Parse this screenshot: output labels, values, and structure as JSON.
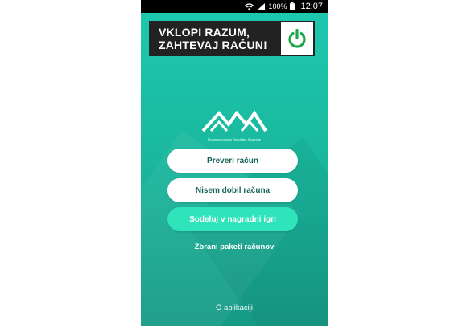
{
  "status_bar": {
    "battery": "100%",
    "time": "12:07"
  },
  "banner": {
    "line1": "VKLOPI RAZUM,",
    "line2": "ZAHTEVAJ RAČUN!",
    "button_icon": "power-icon"
  },
  "logo": {
    "caption": "Finančna uprava Republike Slovenije"
  },
  "buttons": {
    "check_receipt": "Preveri račun",
    "no_receipt": "Nisem dobil računa",
    "prize_game": "Sodeluj v nagradni igri"
  },
  "links": {
    "collected_packages": "Zbrani paketi računov",
    "about": "O aplikaciji"
  },
  "colors": {
    "bg_top": "#1dc9b0",
    "bg_bottom": "#169a86",
    "accent_button": "#2fe3ba",
    "power_green": "#1ea84a"
  }
}
